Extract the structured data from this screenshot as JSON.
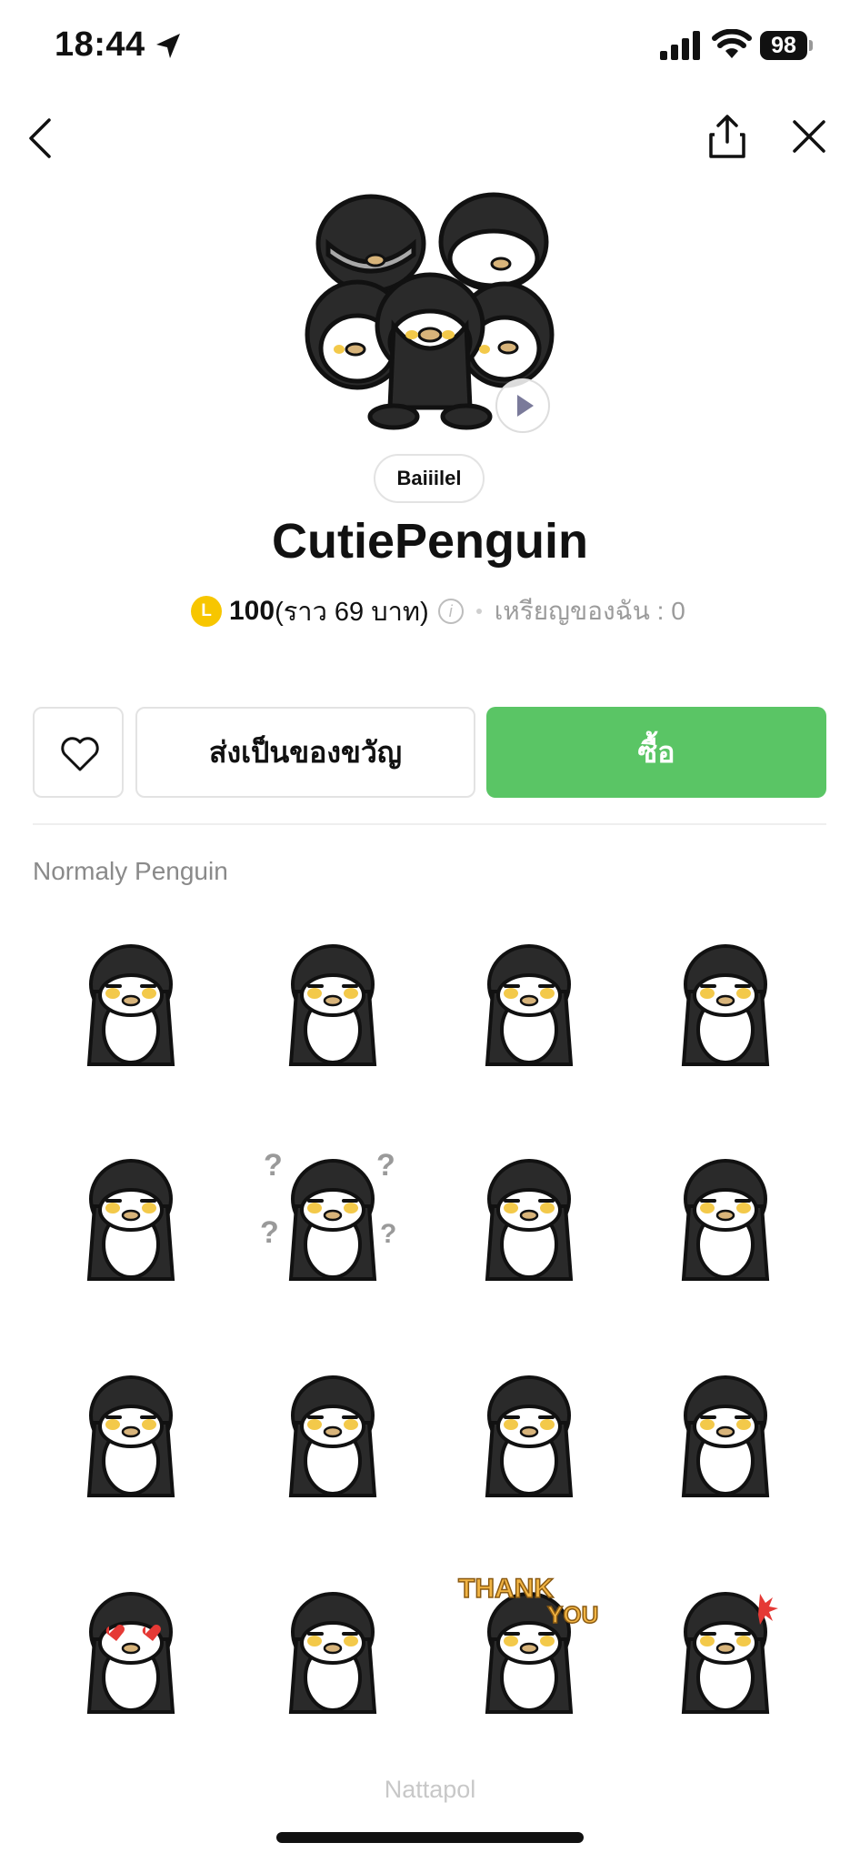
{
  "status_bar": {
    "time": "18:44",
    "battery": "98"
  },
  "icons": {
    "back": "chevron-left-icon",
    "share": "share-icon",
    "close": "close-icon",
    "favorite": "heart-outline-icon",
    "coin": "line-coin-icon",
    "info": "info-icon",
    "play": "play-icon"
  },
  "product": {
    "author": "Baiiilel",
    "title": "CutiePenguin",
    "coin_letter": "L",
    "price_coins": "100",
    "price_approx": "(ราว 69 บาท)",
    "info_glyph": "i",
    "my_coins": "เหรียญของฉัน : 0"
  },
  "actions": {
    "gift_label": "ส่งเป็นของขวัญ",
    "buy_label": "ซื้อ"
  },
  "colors": {
    "buy_green": "#5ac565",
    "coin_yellow": "#f7c600"
  },
  "sticker_section": {
    "label": "Normaly Penguin",
    "stickers": [
      "dizzy-penguin-sticker",
      "sleepy-penguin-sticker",
      "laughing-penguin-sticker",
      "squint-penguin-sticker",
      "standing-penguin-sticker",
      "confused-penguin-sticker",
      "sitting-penguin-sticker",
      "calm-penguin-sticker",
      "small-penguin-sticker",
      "closeup-penguin-sticker",
      "hugging-penguin-sticker",
      "hands-together-penguin-sticker",
      "heart-eyes-penguin-sticker",
      "shy-penguin-sticker",
      "thank-you-penguin-sticker",
      "angry-penguin-sticker"
    ],
    "thank_you_text_1": "THANK",
    "thank_you_text_2": "YOU"
  },
  "footer": {
    "credit": "Nattapol"
  }
}
